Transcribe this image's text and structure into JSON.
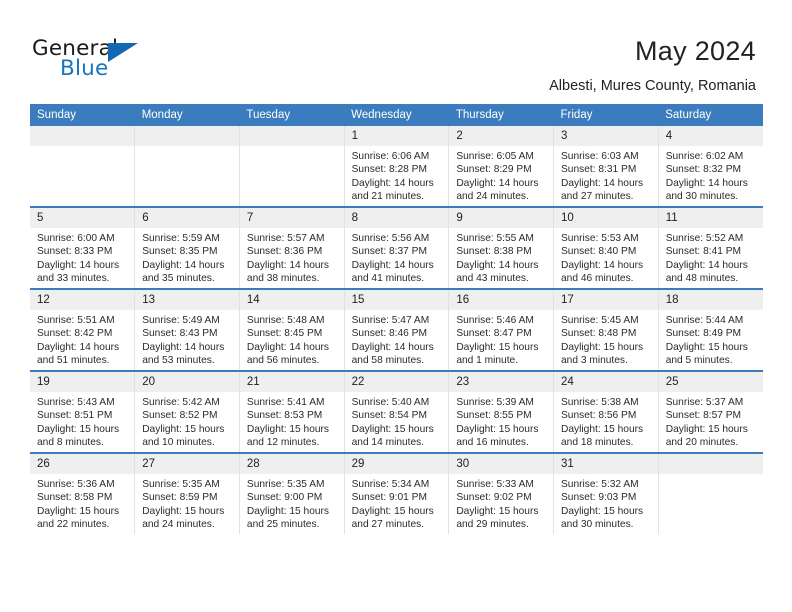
{
  "brand": {
    "name_part1": "General",
    "name_part2": "Blue"
  },
  "header": {
    "title": "May 2024",
    "subtitle": "Albesti, Mures County, Romania"
  },
  "theme": {
    "header_blue": "#3a7cbe",
    "daynum_band": "#efefef",
    "logo_blue": "#1676c0"
  },
  "weekday_headers": [
    "Sunday",
    "Monday",
    "Tuesday",
    "Wednesday",
    "Thursday",
    "Friday",
    "Saturday"
  ],
  "labels": {
    "sunrise": "Sunrise:",
    "sunset": "Sunset:",
    "daylight": "Daylight:"
  },
  "weeks": [
    [
      {
        "day": "",
        "sunrise": "",
        "sunset": "",
        "daylight_line1": "",
        "daylight_line2": ""
      },
      {
        "day": "",
        "sunrise": "",
        "sunset": "",
        "daylight_line1": "",
        "daylight_line2": ""
      },
      {
        "day": "",
        "sunrise": "",
        "sunset": "",
        "daylight_line1": "",
        "daylight_line2": ""
      },
      {
        "day": "1",
        "sunrise": "Sunrise: 6:06 AM",
        "sunset": "Sunset: 8:28 PM",
        "daylight_line1": "Daylight: 14 hours",
        "daylight_line2": "and 21 minutes."
      },
      {
        "day": "2",
        "sunrise": "Sunrise: 6:05 AM",
        "sunset": "Sunset: 8:29 PM",
        "daylight_line1": "Daylight: 14 hours",
        "daylight_line2": "and 24 minutes."
      },
      {
        "day": "3",
        "sunrise": "Sunrise: 6:03 AM",
        "sunset": "Sunset: 8:31 PM",
        "daylight_line1": "Daylight: 14 hours",
        "daylight_line2": "and 27 minutes."
      },
      {
        "day": "4",
        "sunrise": "Sunrise: 6:02 AM",
        "sunset": "Sunset: 8:32 PM",
        "daylight_line1": "Daylight: 14 hours",
        "daylight_line2": "and 30 minutes."
      }
    ],
    [
      {
        "day": "5",
        "sunrise": "Sunrise: 6:00 AM",
        "sunset": "Sunset: 8:33 PM",
        "daylight_line1": "Daylight: 14 hours",
        "daylight_line2": "and 33 minutes."
      },
      {
        "day": "6",
        "sunrise": "Sunrise: 5:59 AM",
        "sunset": "Sunset: 8:35 PM",
        "daylight_line1": "Daylight: 14 hours",
        "daylight_line2": "and 35 minutes."
      },
      {
        "day": "7",
        "sunrise": "Sunrise: 5:57 AM",
        "sunset": "Sunset: 8:36 PM",
        "daylight_line1": "Daylight: 14 hours",
        "daylight_line2": "and 38 minutes."
      },
      {
        "day": "8",
        "sunrise": "Sunrise: 5:56 AM",
        "sunset": "Sunset: 8:37 PM",
        "daylight_line1": "Daylight: 14 hours",
        "daylight_line2": "and 41 minutes."
      },
      {
        "day": "9",
        "sunrise": "Sunrise: 5:55 AM",
        "sunset": "Sunset: 8:38 PM",
        "daylight_line1": "Daylight: 14 hours",
        "daylight_line2": "and 43 minutes."
      },
      {
        "day": "10",
        "sunrise": "Sunrise: 5:53 AM",
        "sunset": "Sunset: 8:40 PM",
        "daylight_line1": "Daylight: 14 hours",
        "daylight_line2": "and 46 minutes."
      },
      {
        "day": "11",
        "sunrise": "Sunrise: 5:52 AM",
        "sunset": "Sunset: 8:41 PM",
        "daylight_line1": "Daylight: 14 hours",
        "daylight_line2": "and 48 minutes."
      }
    ],
    [
      {
        "day": "12",
        "sunrise": "Sunrise: 5:51 AM",
        "sunset": "Sunset: 8:42 PM",
        "daylight_line1": "Daylight: 14 hours",
        "daylight_line2": "and 51 minutes."
      },
      {
        "day": "13",
        "sunrise": "Sunrise: 5:49 AM",
        "sunset": "Sunset: 8:43 PM",
        "daylight_line1": "Daylight: 14 hours",
        "daylight_line2": "and 53 minutes."
      },
      {
        "day": "14",
        "sunrise": "Sunrise: 5:48 AM",
        "sunset": "Sunset: 8:45 PM",
        "daylight_line1": "Daylight: 14 hours",
        "daylight_line2": "and 56 minutes."
      },
      {
        "day": "15",
        "sunrise": "Sunrise: 5:47 AM",
        "sunset": "Sunset: 8:46 PM",
        "daylight_line1": "Daylight: 14 hours",
        "daylight_line2": "and 58 minutes."
      },
      {
        "day": "16",
        "sunrise": "Sunrise: 5:46 AM",
        "sunset": "Sunset: 8:47 PM",
        "daylight_line1": "Daylight: 15 hours",
        "daylight_line2": "and 1 minute."
      },
      {
        "day": "17",
        "sunrise": "Sunrise: 5:45 AM",
        "sunset": "Sunset: 8:48 PM",
        "daylight_line1": "Daylight: 15 hours",
        "daylight_line2": "and 3 minutes."
      },
      {
        "day": "18",
        "sunrise": "Sunrise: 5:44 AM",
        "sunset": "Sunset: 8:49 PM",
        "daylight_line1": "Daylight: 15 hours",
        "daylight_line2": "and 5 minutes."
      }
    ],
    [
      {
        "day": "19",
        "sunrise": "Sunrise: 5:43 AM",
        "sunset": "Sunset: 8:51 PM",
        "daylight_line1": "Daylight: 15 hours",
        "daylight_line2": "and 8 minutes."
      },
      {
        "day": "20",
        "sunrise": "Sunrise: 5:42 AM",
        "sunset": "Sunset: 8:52 PM",
        "daylight_line1": "Daylight: 15 hours",
        "daylight_line2": "and 10 minutes."
      },
      {
        "day": "21",
        "sunrise": "Sunrise: 5:41 AM",
        "sunset": "Sunset: 8:53 PM",
        "daylight_line1": "Daylight: 15 hours",
        "daylight_line2": "and 12 minutes."
      },
      {
        "day": "22",
        "sunrise": "Sunrise: 5:40 AM",
        "sunset": "Sunset: 8:54 PM",
        "daylight_line1": "Daylight: 15 hours",
        "daylight_line2": "and 14 minutes."
      },
      {
        "day": "23",
        "sunrise": "Sunrise: 5:39 AM",
        "sunset": "Sunset: 8:55 PM",
        "daylight_line1": "Daylight: 15 hours",
        "daylight_line2": "and 16 minutes."
      },
      {
        "day": "24",
        "sunrise": "Sunrise: 5:38 AM",
        "sunset": "Sunset: 8:56 PM",
        "daylight_line1": "Daylight: 15 hours",
        "daylight_line2": "and 18 minutes."
      },
      {
        "day": "25",
        "sunrise": "Sunrise: 5:37 AM",
        "sunset": "Sunset: 8:57 PM",
        "daylight_line1": "Daylight: 15 hours",
        "daylight_line2": "and 20 minutes."
      }
    ],
    [
      {
        "day": "26",
        "sunrise": "Sunrise: 5:36 AM",
        "sunset": "Sunset: 8:58 PM",
        "daylight_line1": "Daylight: 15 hours",
        "daylight_line2": "and 22 minutes."
      },
      {
        "day": "27",
        "sunrise": "Sunrise: 5:35 AM",
        "sunset": "Sunset: 8:59 PM",
        "daylight_line1": "Daylight: 15 hours",
        "daylight_line2": "and 24 minutes."
      },
      {
        "day": "28",
        "sunrise": "Sunrise: 5:35 AM",
        "sunset": "Sunset: 9:00 PM",
        "daylight_line1": "Daylight: 15 hours",
        "daylight_line2": "and 25 minutes."
      },
      {
        "day": "29",
        "sunrise": "Sunrise: 5:34 AM",
        "sunset": "Sunset: 9:01 PM",
        "daylight_line1": "Daylight: 15 hours",
        "daylight_line2": "and 27 minutes."
      },
      {
        "day": "30",
        "sunrise": "Sunrise: 5:33 AM",
        "sunset": "Sunset: 9:02 PM",
        "daylight_line1": "Daylight: 15 hours",
        "daylight_line2": "and 29 minutes."
      },
      {
        "day": "31",
        "sunrise": "Sunrise: 5:32 AM",
        "sunset": "Sunset: 9:03 PM",
        "daylight_line1": "Daylight: 15 hours",
        "daylight_line2": "and 30 minutes."
      },
      {
        "day": "",
        "sunrise": "",
        "sunset": "",
        "daylight_line1": "",
        "daylight_line2": ""
      }
    ]
  ]
}
